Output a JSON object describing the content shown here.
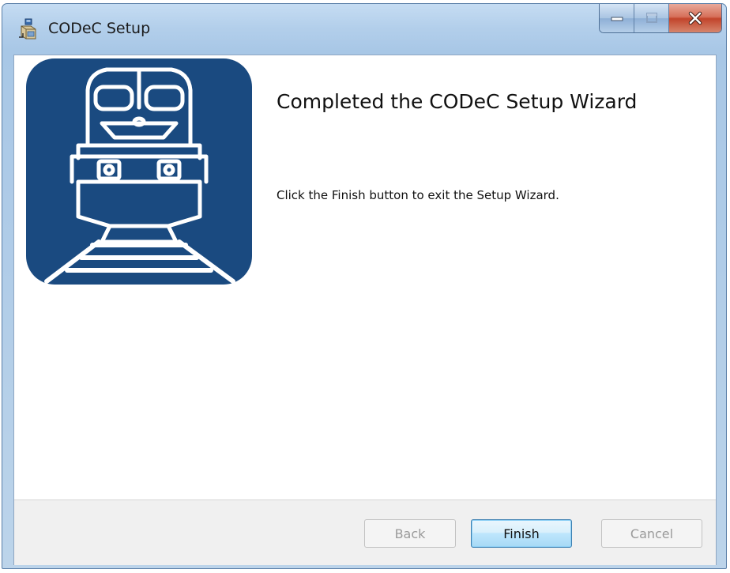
{
  "window": {
    "title": "CODeC Setup",
    "icon": "installer-package-icon"
  },
  "caption_buttons": {
    "minimize_icon": "minimize-icon",
    "maximize_icon": "maximize-icon",
    "close_icon": "close-icon"
  },
  "content": {
    "banner_icon": "train-locomotive-icon",
    "heading": "Completed the CODeC Setup Wizard",
    "body": "Click the Finish button to exit the Setup Wizard."
  },
  "footer": {
    "back_label": "Back",
    "finish_label": "Finish",
    "cancel_label": "Cancel"
  },
  "colors": {
    "banner_blue": "#1a4a80",
    "banner_line": "#ffffff",
    "close_red": "#c2442b",
    "default_button_border": "#3c7fb1"
  }
}
